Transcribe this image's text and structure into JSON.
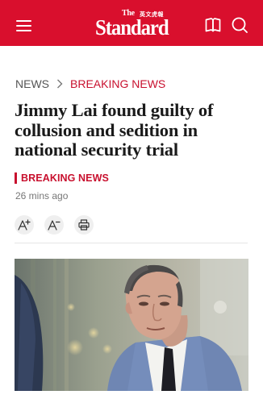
{
  "header": {
    "logo_the": "The",
    "logo_chinese": "英文虎報",
    "logo_main": "Standard"
  },
  "breadcrumb": {
    "home": "NEWS",
    "current": "BREAKING NEWS"
  },
  "article": {
    "headline": "Jimmy Lai found guilty of collusion and sedition in national security trial",
    "category": "BREAKING NEWS",
    "timestamp": "26 mins ago"
  },
  "icons": {
    "menu": "menu-icon",
    "book": "book-icon",
    "search": "search-icon",
    "font_increase": "font-increase-icon",
    "font_decrease": "font-decrease-icon",
    "print": "print-icon"
  },
  "colors": {
    "brand_red": "#d90f2d",
    "accent_red": "#c8102e"
  }
}
